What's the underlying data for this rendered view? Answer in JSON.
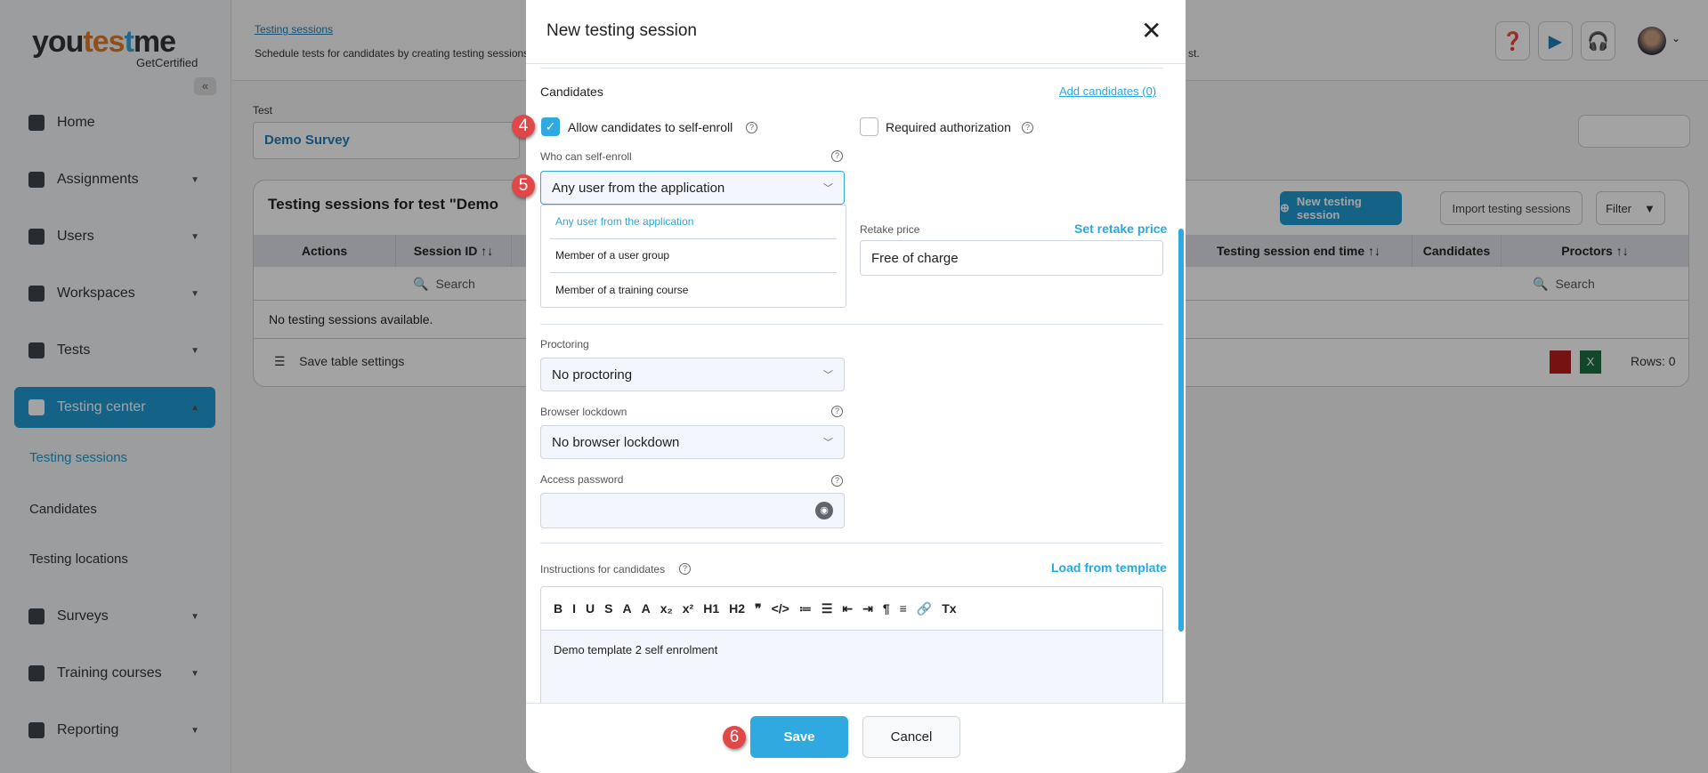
{
  "logo": {
    "name": "youtestme",
    "sub": "GetCertified"
  },
  "sidebar": {
    "items": [
      {
        "label": "Home",
        "icon": "home-icon",
        "expand": false
      },
      {
        "label": "Assignments",
        "icon": "assignments-icon",
        "expand": true
      },
      {
        "label": "Users",
        "icon": "users-icon",
        "expand": true
      },
      {
        "label": "Workspaces",
        "icon": "globe-icon",
        "expand": true
      },
      {
        "label": "Tests",
        "icon": "tests-icon",
        "expand": true
      },
      {
        "label": "Testing center",
        "icon": "calendar-icon",
        "expand": true,
        "active": true
      },
      {
        "label": "Surveys",
        "icon": "survey-icon",
        "expand": true
      },
      {
        "label": "Training courses",
        "icon": "trophy-icon",
        "expand": true
      },
      {
        "label": "Reporting",
        "icon": "report-icon",
        "expand": true
      }
    ],
    "subitems": [
      "Testing sessions",
      "Candidates",
      "Testing locations"
    ]
  },
  "header": {
    "breadcrumb": "Testing sessions",
    "description": "Schedule tests for candidates by creating testing sessions",
    "description_tail": "st."
  },
  "test": {
    "label": "Test",
    "value": "Demo Survey"
  },
  "table": {
    "title": "Testing sessions for test \"Demo",
    "new_button": "New testing session",
    "import_button": "Import testing sessions",
    "filter_button": "Filter",
    "columns": [
      "Actions",
      "Session ID ↑↓",
      "Testing session end time ↑↓",
      "Candidates",
      "Proctors ↑↓"
    ],
    "search_placeholder": "Search",
    "empty": "No testing sessions available.",
    "save_settings": "Save table settings",
    "rows": "Rows: 0"
  },
  "modal": {
    "title": "New testing session",
    "candidates_heading": "Candidates",
    "add_candidates": "Add candidates (0)",
    "allow_self_enroll": "Allow candidates to self-enroll",
    "allow_self_enroll_checked": true,
    "required_authorization": "Required authorization",
    "required_authorization_checked": false,
    "who_label": "Who can self-enroll",
    "who_value": "Any user from the application",
    "who_options": [
      "Any user from the application",
      "Member of a user group",
      "Member of a training course"
    ],
    "retake_label": "Retake price",
    "retake_link": "Set retake price",
    "retake_value": "Free of charge",
    "proctoring_label": "Proctoring",
    "proctoring_value": "No proctoring",
    "lockdown_label": "Browser lockdown",
    "lockdown_value": "No browser lockdown",
    "password_label": "Access password",
    "password_value": "",
    "instructions_label": "Instructions for candidates",
    "load_template": "Load from template",
    "toolbar": [
      "B",
      "I",
      "U",
      "S",
      "A",
      "A",
      "x₂",
      "x²",
      "H1",
      "H2",
      "❞",
      "</>",
      "≔",
      "☰",
      "⇤",
      "⇥",
      "¶",
      "≡",
      "🔗",
      "Tx"
    ],
    "instructions_text": "Demo template 2 self enrolment",
    "save": "Save",
    "cancel": "Cancel"
  },
  "badges": [
    "4",
    "5",
    "6"
  ],
  "colors": {
    "accent": "#2fa9df",
    "badge": "#e04848"
  }
}
